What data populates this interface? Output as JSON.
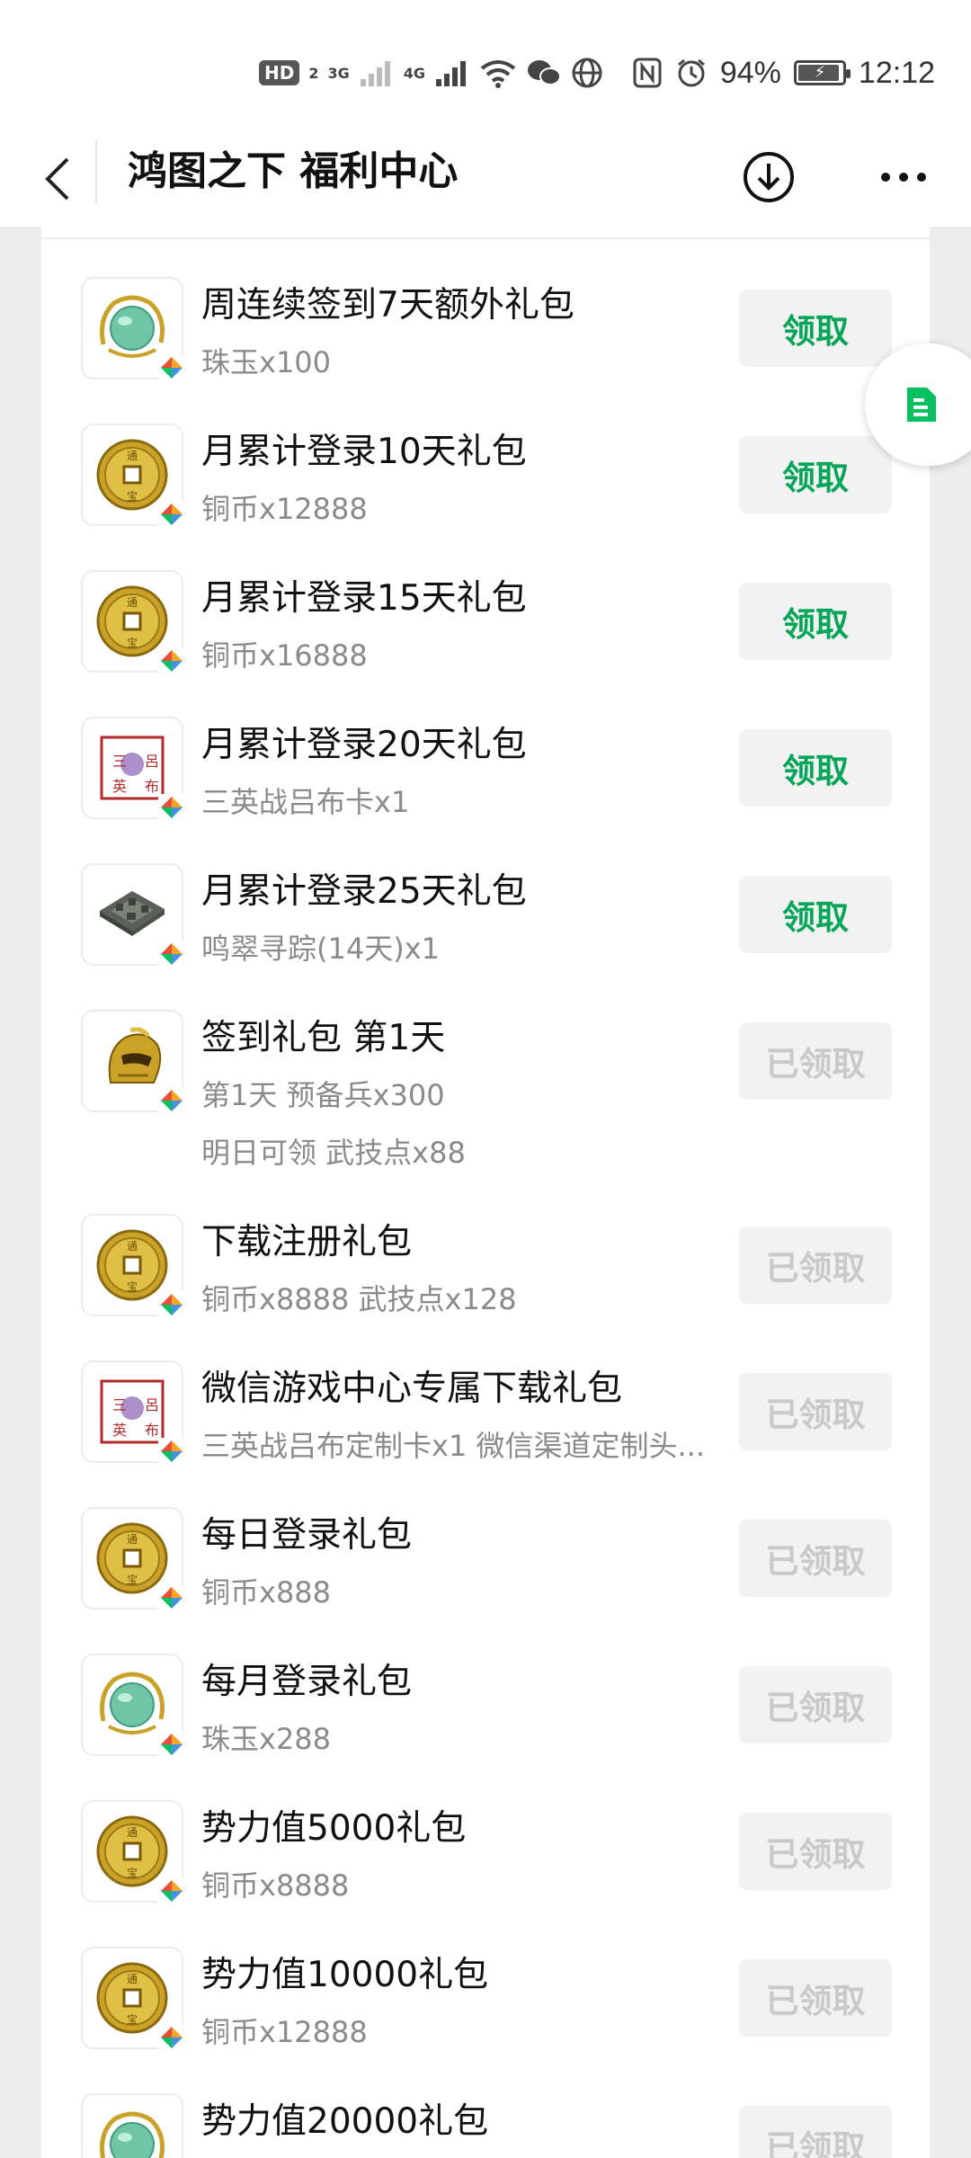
{
  "status_bar": {
    "hd_label": "HD",
    "sim_slot": "2",
    "net1": "3G",
    "net2": "4G",
    "battery_text": "94%",
    "battery_level": 0.94,
    "time": "12:12"
  },
  "nav": {
    "title": "鸿图之下 福利中心"
  },
  "gifts": [
    {
      "title": "周连续签到7天额外礼包",
      "desc": [
        "珠玉x100"
      ],
      "button": "领取",
      "state": "active",
      "icon": "jade-icon"
    },
    {
      "title": "月累计登录10天礼包",
      "desc": [
        "铜币x12888"
      ],
      "button": "领取",
      "state": "active",
      "icon": "coin-icon"
    },
    {
      "title": "月累计登录15天礼包",
      "desc": [
        "铜币x16888"
      ],
      "button": "领取",
      "state": "active",
      "icon": "coin-icon"
    },
    {
      "title": "月累计登录20天礼包",
      "desc": [
        "三英战吕布卡x1"
      ],
      "button": "领取",
      "state": "active",
      "icon": "seal-icon"
    },
    {
      "title": "月累计登录25天礼包",
      "desc": [
        "鸣翠寻踪(14天)x1"
      ],
      "button": "领取",
      "state": "active",
      "icon": "city-icon"
    },
    {
      "title": "签到礼包 第1天",
      "desc": [
        "第1天 预备兵x300",
        "明日可领 武技点x88"
      ],
      "button": "已领取",
      "state": "done",
      "icon": "helmet-icon"
    },
    {
      "title": "下载注册礼包",
      "desc": [
        "铜币x8888 武技点x128"
      ],
      "button": "已领取",
      "state": "done",
      "icon": "coin-icon"
    },
    {
      "title": "微信游戏中心专属下载礼包",
      "desc": [
        "三英战吕布定制卡x1 微信渠道定制头..."
      ],
      "button": "已领取",
      "state": "done",
      "icon": "seal-icon"
    },
    {
      "title": "每日登录礼包",
      "desc": [
        "铜币x888"
      ],
      "button": "已领取",
      "state": "done",
      "icon": "coin-icon"
    },
    {
      "title": "每月登录礼包",
      "desc": [
        "珠玉x288"
      ],
      "button": "已领取",
      "state": "done",
      "icon": "jade-icon"
    },
    {
      "title": "势力值5000礼包",
      "desc": [
        "铜币x8888"
      ],
      "button": "已领取",
      "state": "done",
      "icon": "coin-icon"
    },
    {
      "title": "势力值10000礼包",
      "desc": [
        "铜币x12888"
      ],
      "button": "已领取",
      "state": "done",
      "icon": "coin-icon"
    },
    {
      "title": "势力值20000礼包",
      "desc": [],
      "button": "已领取",
      "state": "done",
      "icon": "jade-icon"
    }
  ],
  "colors": {
    "accent_green": "#07a557",
    "disabled_text": "#c9c9c9",
    "button_bg": "#f2f2f2"
  }
}
